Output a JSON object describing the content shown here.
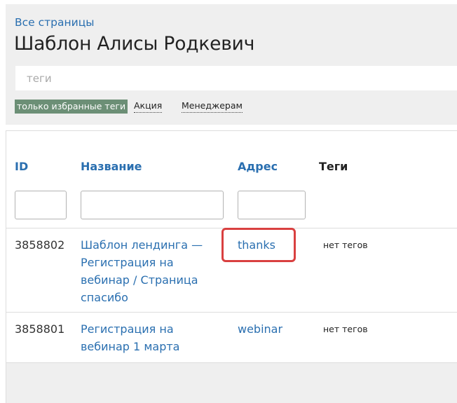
{
  "header": {
    "all_pages_link": "Все страницы",
    "title": "Шаблон Алисы Родкевич",
    "tags_placeholder": "теги",
    "tag_filters": [
      {
        "label": "только избранные теги",
        "selected": true
      },
      {
        "label": "Акция",
        "selected": false
      },
      {
        "label": "Менеджерам",
        "selected": false
      }
    ]
  },
  "table": {
    "columns": {
      "id": "ID",
      "name": "Название",
      "address": "Адрес",
      "tags": "Теги"
    },
    "filters": {
      "id": "",
      "name": "",
      "address": ""
    },
    "rows": [
      {
        "id": "3858802",
        "name_lines": [
          "Шаблон лендинга —",
          "Регистрация на",
          "вебинар / Страница",
          "спасибо"
        ],
        "address": "thanks",
        "tags": "нет тегов",
        "highlighted": true
      },
      {
        "id": "3858801",
        "name_lines": [
          "Регистрация на",
          "вебинар 1 марта"
        ],
        "address": "webinar",
        "tags": "нет тегов",
        "highlighted": false
      }
    ]
  },
  "colors": {
    "link": "#2a6fb0",
    "header_bg": "#efefef",
    "selected_tag_bg": "#6c8f76",
    "highlight_border": "#d94040"
  }
}
